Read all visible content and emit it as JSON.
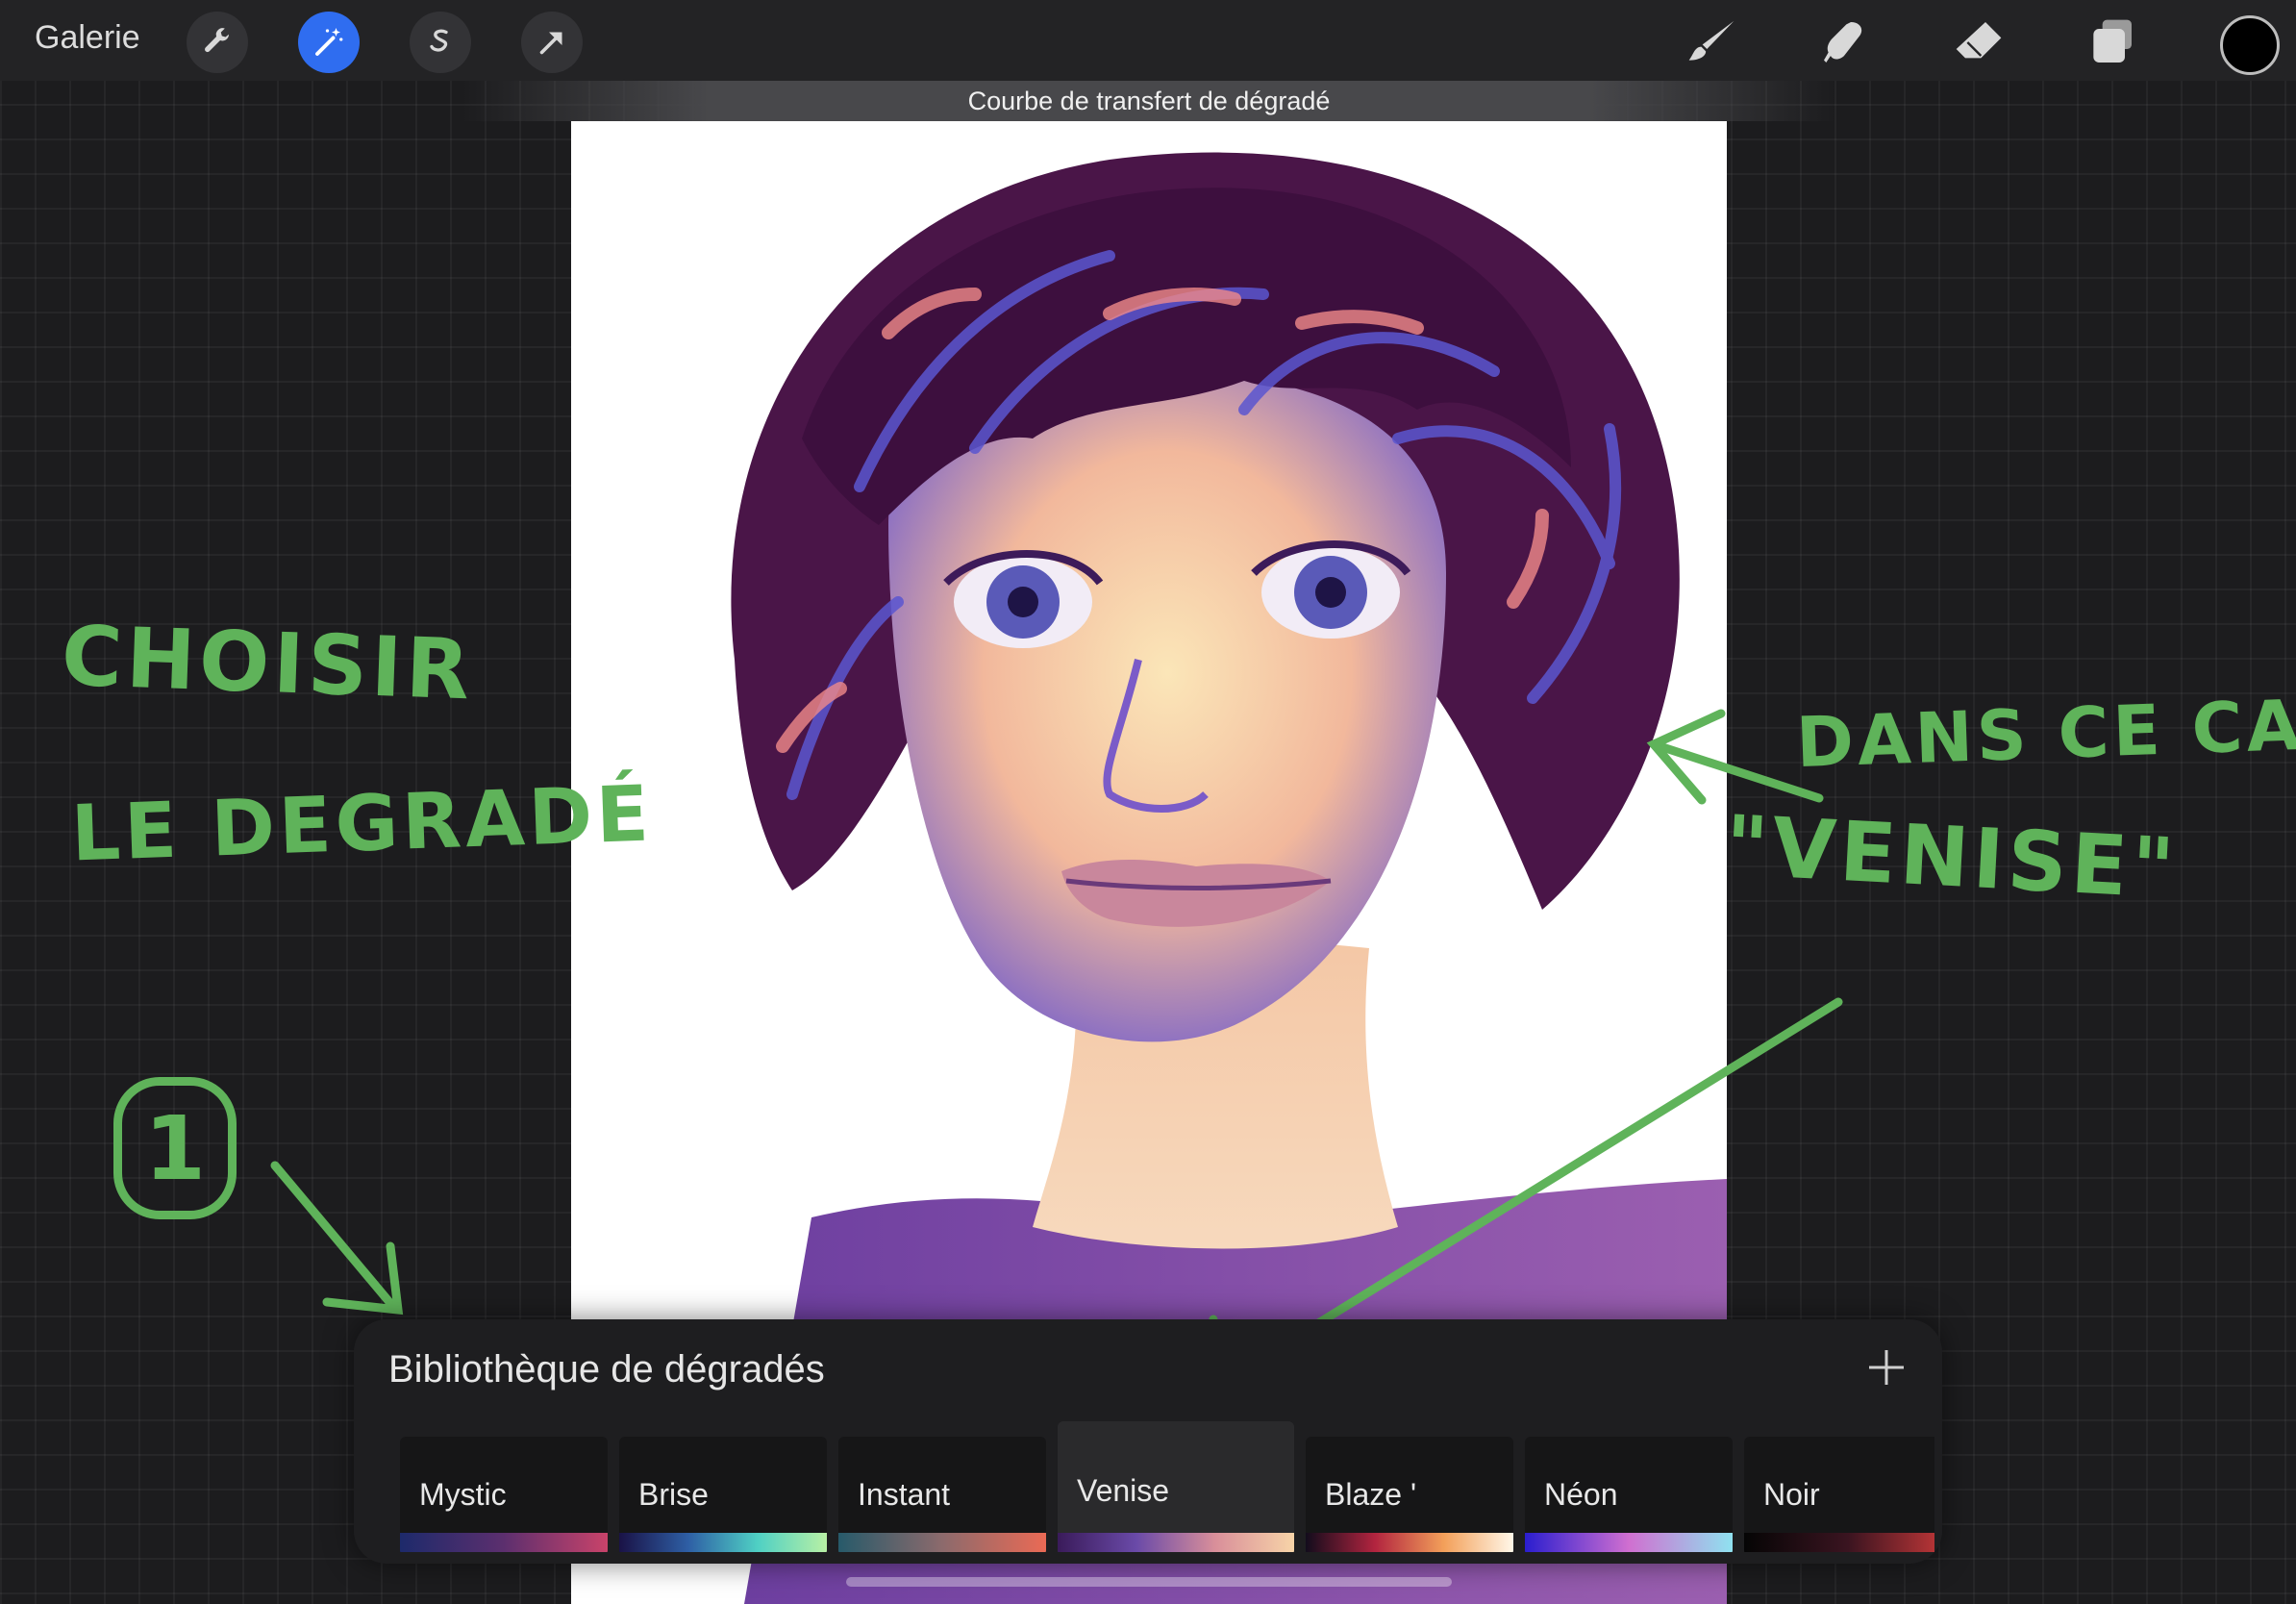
{
  "toolbar": {
    "gallery_label": "Galerie",
    "left_tools": [
      "wrench-icon",
      "magic-wand-icon",
      "selection-icon",
      "transform-arrow-icon"
    ],
    "right_tools": [
      "brush-icon",
      "smudge-icon",
      "eraser-icon",
      "layers-icon"
    ],
    "current_color": "#000000"
  },
  "mode_subtitle": "Courbe de transfert de dégradé",
  "annotations": {
    "line1": "CHOISIR",
    "line2": "LE DEGRADÉ",
    "line3": "DANS CE CAS",
    "line4": "\"VENISE\"",
    "step_number": "1"
  },
  "gradient_library": {
    "title": "Bibliothèque de dégradés",
    "selected": "Venise",
    "items": [
      {
        "name": "Mystic",
        "colors": [
          "#1d2a6b",
          "#5c2f6e",
          "#c9436a"
        ]
      },
      {
        "name": "Brise",
        "colors": [
          "#1a1246",
          "#2e5fa5",
          "#4fd0c4",
          "#b8f0a5"
        ]
      },
      {
        "name": "Instant",
        "colors": [
          "#275a6a",
          "#8c6a6c",
          "#ea6a55"
        ]
      },
      {
        "name": "Venise",
        "colors": [
          "#3a1b5a",
          "#6a4aa8",
          "#d98f9a",
          "#f7d4a8"
        ]
      },
      {
        "name": "Blaze '",
        "colors": [
          "#120c1c",
          "#b2243f",
          "#f3a05a",
          "#fff7e8"
        ]
      },
      {
        "name": "Néon",
        "colors": [
          "#2a1ecf",
          "#d06fd0",
          "#8fe2f0"
        ]
      },
      {
        "name": "Noir",
        "colors": [
          "#050505",
          "#3a1420",
          "#cc3a3a"
        ]
      }
    ]
  },
  "colors": {
    "accent": "#2f6df0",
    "annotation_green": "#5fb35a"
  }
}
